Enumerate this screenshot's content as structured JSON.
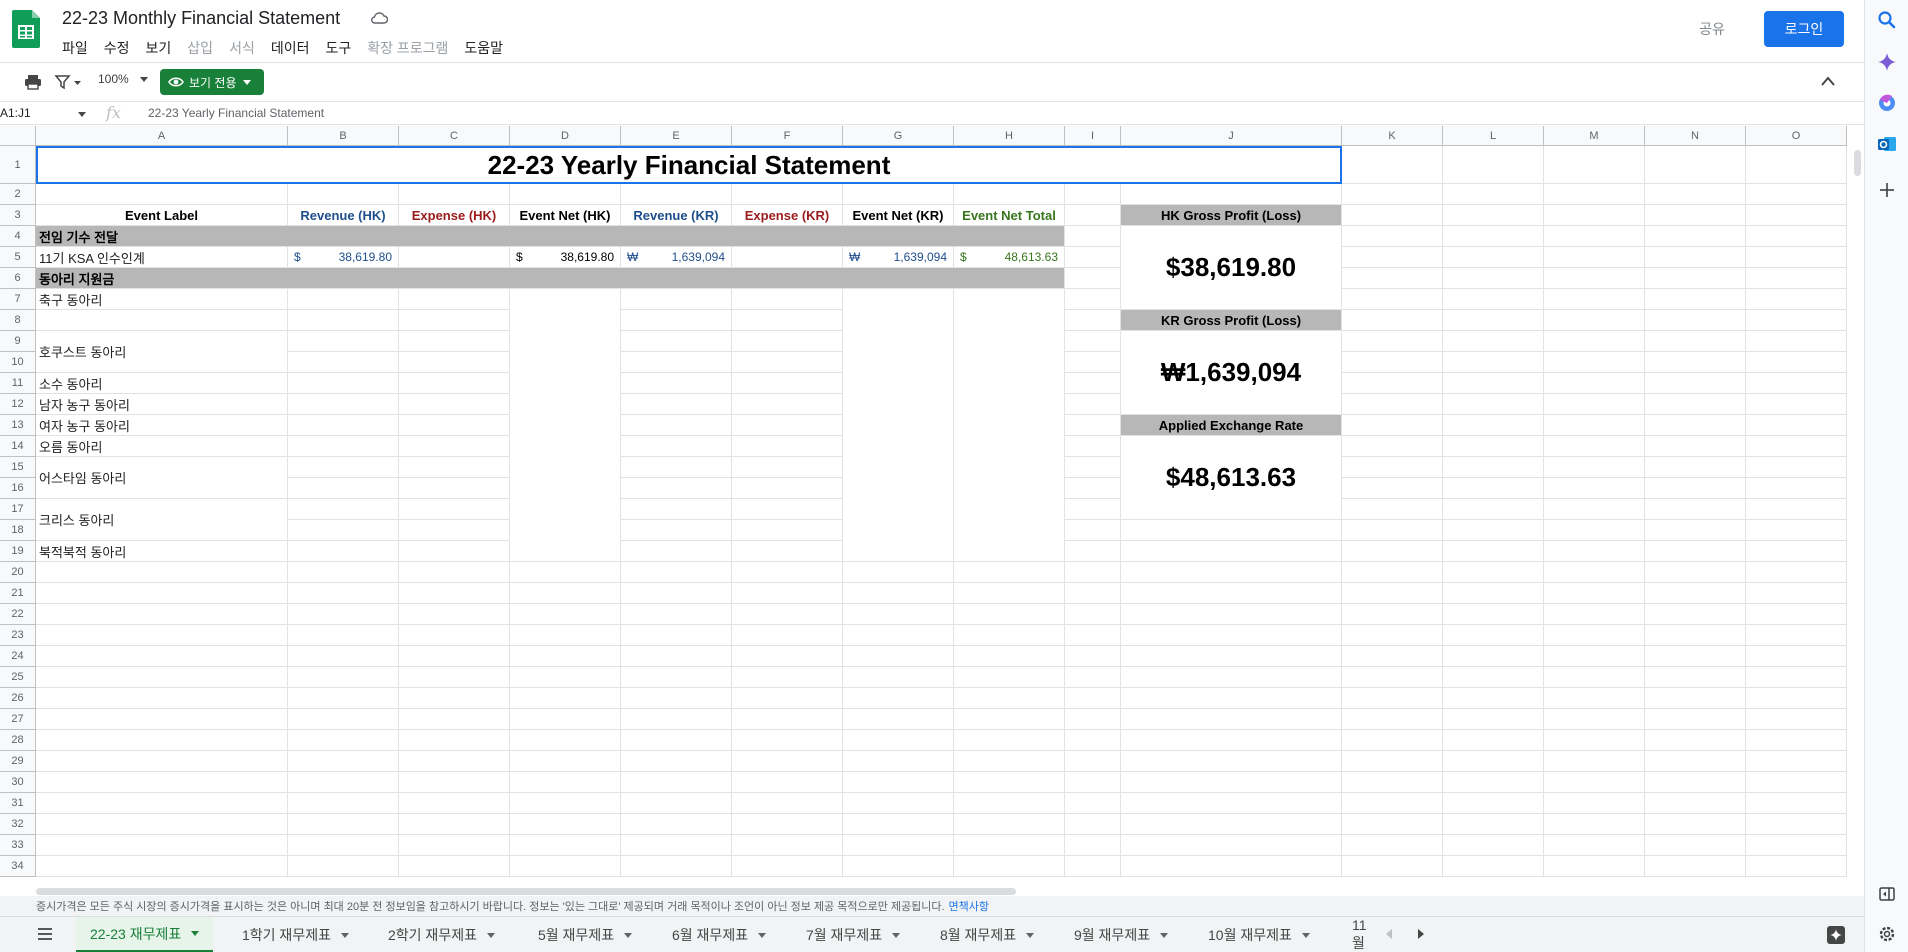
{
  "app": {
    "title": "22-23 Monthly Financial Statement",
    "menus": [
      {
        "label": "파일",
        "enabled": true
      },
      {
        "label": "수정",
        "enabled": true
      },
      {
        "label": "보기",
        "enabled": true
      },
      {
        "label": "삽입",
        "enabled": false
      },
      {
        "label": "서식",
        "enabled": false
      },
      {
        "label": "데이터",
        "enabled": true
      },
      {
        "label": "도구",
        "enabled": true
      },
      {
        "label": "확장 프로그램",
        "enabled": false
      },
      {
        "label": "도움말",
        "enabled": true
      }
    ],
    "share_label": "공유",
    "login_label": "로그인",
    "colors": {
      "accent": "#1a73e8",
      "view_only": "#188038",
      "header_fill": "#b7b7b7"
    }
  },
  "toolbar": {
    "zoom": "100%",
    "view_only_label": "보기 전용",
    "icons": [
      "print-icon",
      "filter-icon",
      "eye-icon",
      "collapse-icon"
    ]
  },
  "formula_bar": {
    "namebox": "A1:J1",
    "fx_label": "fx",
    "content": "22-23 Yearly Financial Statement"
  },
  "sheet": {
    "columns": [
      "A",
      "B",
      "C",
      "D",
      "E",
      "F",
      "G",
      "H",
      "I",
      "J",
      "K",
      "L",
      "M",
      "N",
      "O"
    ],
    "rows": [
      "1",
      "2",
      "3",
      "4",
      "5",
      "6",
      "7",
      "8",
      "9",
      "10",
      "11",
      "12",
      "13",
      "14",
      "15",
      "16",
      "17",
      "18",
      "19",
      "20",
      "21",
      "22",
      "23",
      "24",
      "25",
      "26",
      "27",
      "28",
      "29",
      "30",
      "31",
      "32",
      "33",
      "34"
    ],
    "title": "22-23 Yearly Financial Statement",
    "headers": {
      "event_label": "Event Label",
      "revenue_hk": "Revenue (HK)",
      "expense_hk": "Expense (HK)",
      "net_hk": "Event Net (HK)",
      "revenue_kr": "Revenue (KR)",
      "expense_kr": "Expense (KR)",
      "net_kr": "Event Net (KR)",
      "net_total": "Event Net Total"
    },
    "section_1": "전임 기수 전달",
    "row5": {
      "label": "11기 KSA 인수인계",
      "rev_hk_sym": "$",
      "rev_hk": "38,619.80",
      "net_hk_sym": "$",
      "net_hk": "38,619.80",
      "rev_kr_sym": "₩",
      "rev_kr": "1,639,094",
      "net_kr_sym": "₩",
      "net_kr": "1,639,094",
      "total_sym": "$",
      "total": "48,613.63"
    },
    "section_2": "동아리 지원금",
    "clubs": {
      "r7": "축구 동아리",
      "r9": "호쿠스트 동아리",
      "r11": "소수 동아리",
      "r12": "남자 농구 동아리",
      "r13": "여자 농구 동아리",
      "r14": "오름 동아리",
      "r15": "어스타임 동아리",
      "r17": "크리스 동아리",
      "r19": "북적북적 동아리"
    },
    "summary": {
      "hk_label": "HK Gross Profit (Loss)",
      "hk_value": "$38,619.80",
      "kr_label": "KR Gross Profit (Loss)",
      "kr_value": "₩1,639,094",
      "rate_label": "Applied Exchange Rate",
      "rate_value": "$48,613.63"
    }
  },
  "disclaimer": {
    "text": "증시가격은 모든 주식 시장의 증시가격을 표시하는 것은 아니며 최대 20분 전 정보임을 참고하시기 바랍니다. 정보는 '있는 그대로' 제공되며 거래 목적이나 조언이 아닌 정보 제공 목적으로만 제공됩니다.",
    "link": "면책사항"
  },
  "tabs": [
    {
      "label": "22-23 재무제표",
      "active": true
    },
    {
      "label": "1학기 재무제표",
      "active": false
    },
    {
      "label": "2학기 재무제표",
      "active": false
    },
    {
      "label": "5월 재무제표",
      "active": false
    },
    {
      "label": "6월 재무제표",
      "active": false
    },
    {
      "label": "7월 재무제표",
      "active": false
    },
    {
      "label": "8월 재무제표",
      "active": false
    },
    {
      "label": "9월 재무제표",
      "active": false
    },
    {
      "label": "10월 재무제표",
      "active": false
    },
    {
      "label": "11월",
      "active": false
    }
  ]
}
